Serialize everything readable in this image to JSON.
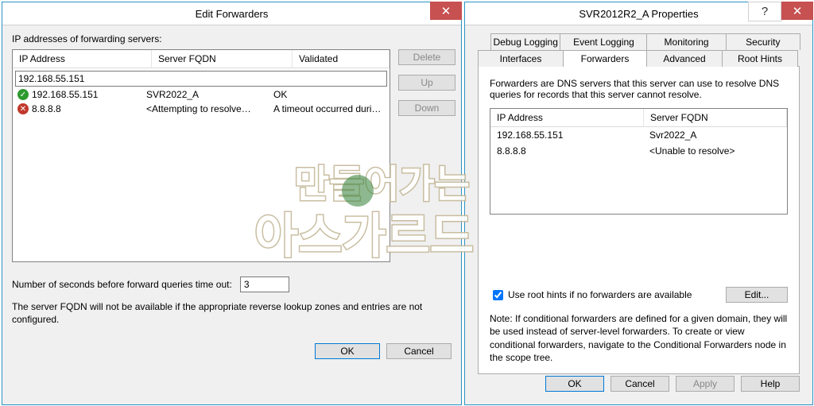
{
  "left": {
    "title": "Edit Forwarders",
    "label": "IP addresses of forwarding servers:",
    "cols": {
      "ip": "IP Address",
      "fqdn": "Server FQDN",
      "val": "Validated"
    },
    "input_value": "192.168.55.151",
    "rows": [
      {
        "icon": "ok",
        "ip": "192.168.55.151",
        "fqdn": "SVR2022_A",
        "val": "OK"
      },
      {
        "icon": "err",
        "ip": "8.8.8.8",
        "fqdn": "<Attempting to resolve…",
        "val": "A timeout occurred duri…"
      }
    ],
    "btns": {
      "delete": "Delete",
      "up": "Up",
      "down": "Down"
    },
    "timeout_label": "Number of seconds before forward queries time out:",
    "timeout_value": "3",
    "note": "The server FQDN will not be available if the appropriate reverse lookup zones and entries are not configured.",
    "ok": "OK",
    "cancel": "Cancel"
  },
  "right": {
    "title": "SVR2012R2_A Properties",
    "tabs_row1": [
      "Debug Logging",
      "Event Logging",
      "Monitoring",
      "Security"
    ],
    "tabs_row2": [
      "Interfaces",
      "Forwarders",
      "Advanced",
      "Root Hints"
    ],
    "active_tab": "Forwarders",
    "desc": "Forwarders are DNS servers that this server can use to resolve DNS queries for records that this server cannot resolve.",
    "cols": {
      "ip": "IP Address",
      "fqdn": "Server FQDN"
    },
    "rows": [
      {
        "ip": "192.168.55.151",
        "fqdn": "Svr2022_A"
      },
      {
        "ip": "8.8.8.8",
        "fqdn": "<Unable to resolve>"
      }
    ],
    "use_root_hints": "Use root hints if no forwarders are available",
    "use_root_hints_checked": true,
    "edit": "Edit...",
    "note": "Note: If conditional forwarders are defined for a given domain, they will be used instead of server-level forwarders.  To create or view conditional forwarders, navigate to the Conditional Forwarders node in the scope tree.",
    "ok": "OK",
    "cancel": "Cancel",
    "apply": "Apply",
    "help": "Help"
  },
  "watermark": {
    "line1": "만들어가는",
    "line2": "아스가르드"
  }
}
